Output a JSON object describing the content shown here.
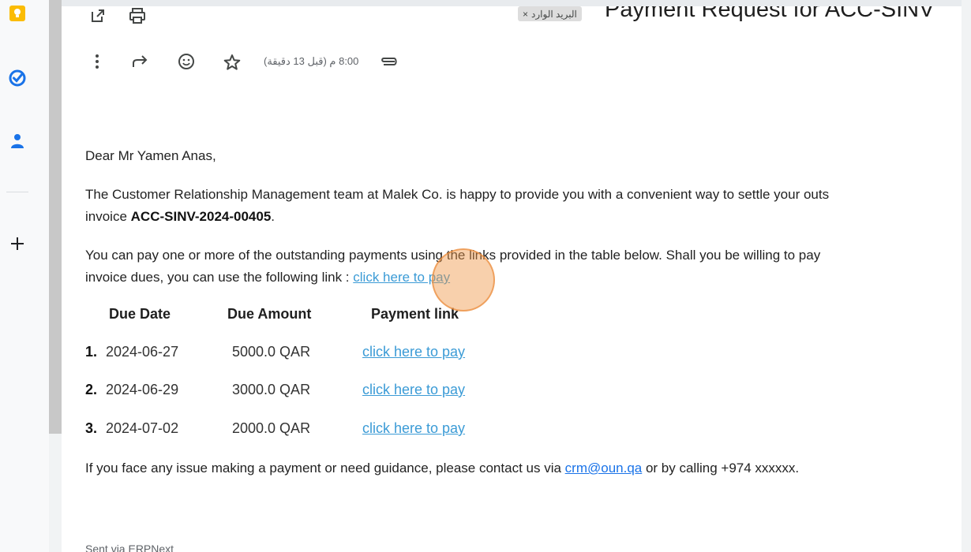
{
  "email": {
    "subject": "Payment Request for ACC-SINV",
    "label_chip": "البريد الوارد",
    "label_chip_close": "×",
    "time": "8:00 م (قبل 13 دقيقة)",
    "greeting": "Dear Mr Yamen Anas,",
    "para1_line1": "The Customer Relationship Management team at Malek Co. is happy to provide you with a convenient way to settle your outs",
    "para1_line2_prefix": "invoice ",
    "invoice_id": "ACC-SINV-2024-00405",
    "para1_line2_suffix": ".",
    "para2_line1": "You can pay one or more of the outstanding payments using the links provided in the table below. Shall you be willing to pay",
    "para2_line2_prefix": "invoice dues, you can use the following link : ",
    "para2_link": "click here to pay",
    "table": {
      "headers": [
        "Due Date",
        "Due Amount",
        "Payment link"
      ],
      "rows": [
        {
          "num": "1.",
          "date": "2024-06-27",
          "amount": "5000.0 QAR",
          "link": "click here to pay"
        },
        {
          "num": "2.",
          "date": "2024-06-29",
          "amount": "3000.0 QAR",
          "link": "click here to pay"
        },
        {
          "num": "3.",
          "date": "2024-07-02",
          "amount": "2000.0 QAR",
          "link": "click here to pay"
        }
      ]
    },
    "contact_prefix": "If you face any issue making a payment or need guidance, please contact us via ",
    "contact_email": "crm@oun.qa",
    "contact_suffix": " or by calling +974 xxxxxx.",
    "footer": "Sent via ERPNext"
  },
  "icons": {
    "rail": [
      "keep-icon",
      "tasks-icon",
      "contacts-icon",
      "add-icon"
    ],
    "toolbar": [
      "open-in-new-window-icon",
      "print-icon",
      "more-vert-icon",
      "forward-icon",
      "emoji-icon",
      "star-icon",
      "attachment-icon"
    ]
  },
  "colors": {
    "link": "#1a73e8",
    "keep": "#fbbc04",
    "tasks": "#1a73e8",
    "contacts": "#1a73e8",
    "click_indicator": "#f0a060"
  }
}
